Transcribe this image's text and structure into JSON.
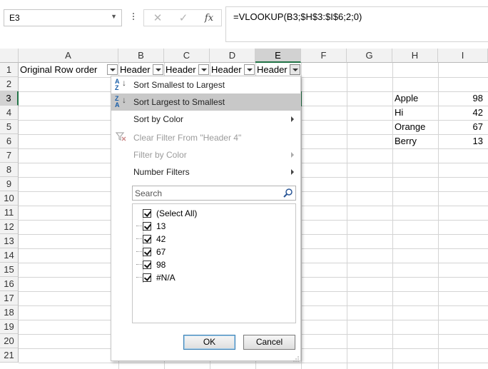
{
  "formula_bar": {
    "name_box": "E3",
    "cancel_glyph": "✕",
    "enter_glyph": "✓",
    "fx_label": "fx",
    "formula": "=VLOOKUP(B3;$H$3:$I$6;2;0)"
  },
  "columns": [
    "A",
    "B",
    "C",
    "D",
    "E",
    "F",
    "G",
    "H",
    "I"
  ],
  "selected_column": "E",
  "rows": [
    "1",
    "2",
    "3",
    "4",
    "5",
    "6",
    "7",
    "8",
    "9",
    "10",
    "11",
    "12",
    "13",
    "14",
    "15",
    "16",
    "17",
    "18",
    "19",
    "20",
    "21"
  ],
  "selected_row": "3",
  "header_row": {
    "a1": "Original Row order",
    "b1": "Header",
    "c1": "Header",
    "d1": "Header",
    "e1": "Header"
  },
  "lookup_table": [
    {
      "name": "Apple",
      "value": "98"
    },
    {
      "name": "Hi",
      "value": "42"
    },
    {
      "name": "Orange",
      "value": "67"
    },
    {
      "name": "Berry",
      "value": "13"
    }
  ],
  "filter_menu": {
    "sort_asc": "Sort Smallest to Largest",
    "sort_desc": "Sort Largest to Smallest",
    "sort_color": "Sort by Color",
    "clear_filter": "Clear Filter From \"Header 4\"",
    "filter_color": "Filter by Color",
    "number_filters": "Number Filters",
    "search_placeholder": "Search",
    "items": [
      {
        "label": "(Select All)",
        "checked": true
      },
      {
        "label": "13",
        "checked": true
      },
      {
        "label": "42",
        "checked": true
      },
      {
        "label": "67",
        "checked": true
      },
      {
        "label": "98",
        "checked": true
      },
      {
        "label": "#N/A",
        "checked": true
      }
    ],
    "ok_label": "OK",
    "cancel_label": "Cancel"
  },
  "colors": {
    "selection_green": "#217346",
    "highlight_yellow": "#e4e800",
    "menu_hover": "#c8c8c8"
  }
}
